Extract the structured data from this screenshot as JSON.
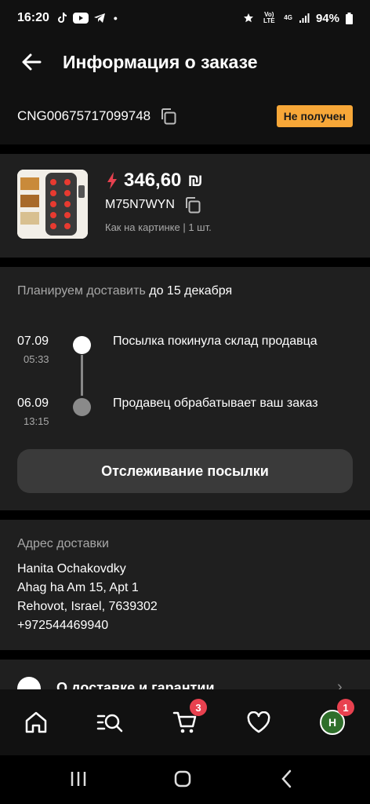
{
  "status_bar": {
    "time": "16:20",
    "signal_labels": {
      "volte": "Vo) LTE",
      "net": "4G"
    },
    "battery": "94%"
  },
  "header": {
    "title": "Информация о заказе"
  },
  "order": {
    "id": "CNG00675717099748",
    "status": "Не получен",
    "status_color": "#f7a738"
  },
  "product": {
    "price": "346,60",
    "currency_symbol": "₪",
    "sku": "M75N7WYN",
    "variant": "Как на картинке | 1 шт.",
    "accent": "#e8414f"
  },
  "delivery": {
    "plan_prefix": "Планируем доставить",
    "plan_date": "до 15 декабря",
    "events": [
      {
        "date": "07.09",
        "time": "05:33",
        "text": "Посылка покинула склад продавца",
        "active": true
      },
      {
        "date": "06.09",
        "time": "13:15",
        "text": "Продавец обрабатывает ваш заказ",
        "active": false
      }
    ],
    "track_button": "Отслеживание посылки"
  },
  "address": {
    "title": "Адрес доставки",
    "lines": [
      "Hanita Ochakovdky",
      "Ahag ha Am 15, Apt 1",
      "Rehovot, Israel, 7639302",
      "+972544469940"
    ]
  },
  "more": {
    "label": "О доставке и гарантии"
  },
  "tabbar": {
    "items": [
      {
        "icon": "home-icon"
      },
      {
        "icon": "catalog-search-icon"
      },
      {
        "icon": "cart-icon",
        "badge": "3"
      },
      {
        "icon": "heart-icon"
      },
      {
        "icon": "avatar",
        "initial": "H",
        "badge": "1"
      }
    ]
  }
}
